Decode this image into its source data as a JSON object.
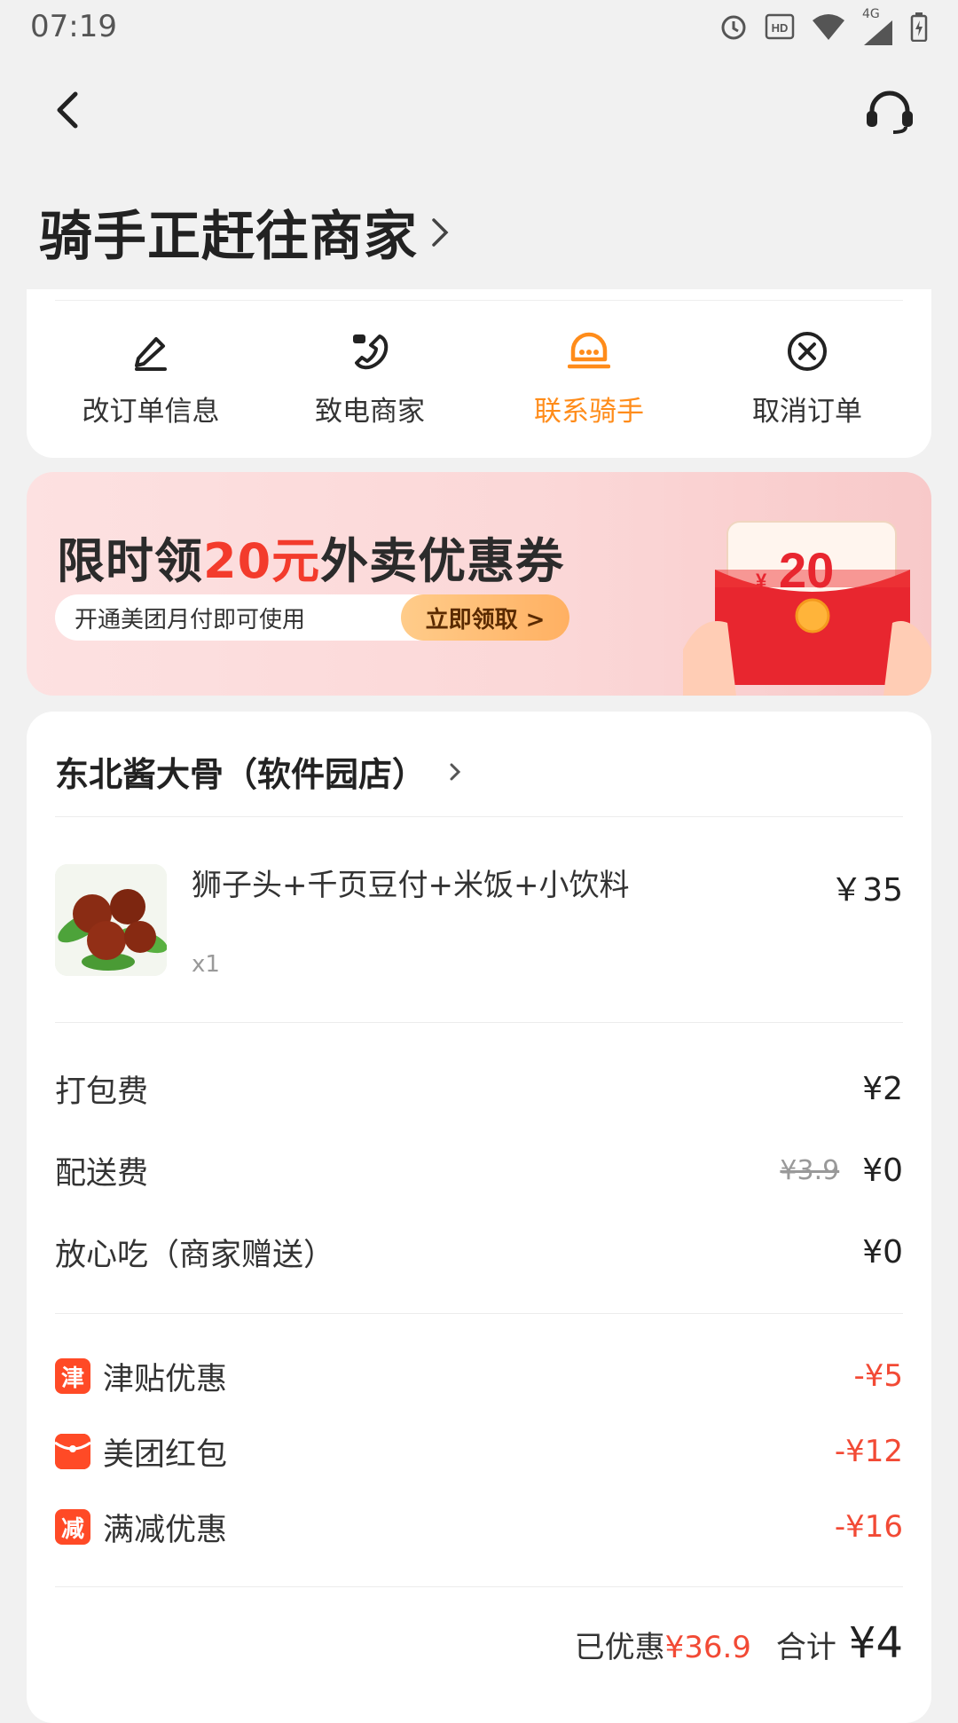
{
  "status_bar": {
    "time": "07:19",
    "network": "4G"
  },
  "header": {
    "title": "骑手正赶往商家"
  },
  "actions": [
    {
      "label": "改订单信息",
      "icon": "pencil-icon"
    },
    {
      "label": "致电商家",
      "icon": "phone-icon"
    },
    {
      "label": "联系骑手",
      "icon": "chat-icon",
      "highlight": "#ff8c1a"
    },
    {
      "label": "取消订单",
      "icon": "cancel-icon"
    }
  ],
  "banner": {
    "title_prefix": "限时领",
    "title_highlight": "20元",
    "title_suffix": "外卖优惠券",
    "subtitle": "开通美团月付即可使用",
    "cta": "立即领取 >",
    "coupon_currency": "¥",
    "coupon_amount": "20"
  },
  "order": {
    "shop_name": "东北酱大骨（软件园店）",
    "item": {
      "name": "狮子头+千页豆付+米饭+小饮料",
      "qty": "x1",
      "price": "￥35"
    },
    "fees": [
      {
        "label": "打包费",
        "value": "¥2"
      },
      {
        "label": "配送费",
        "original": "¥3.9",
        "value": "¥0"
      },
      {
        "label": "放心吃（商家赠送）",
        "value": "¥0"
      }
    ],
    "discounts": [
      {
        "badge": "津",
        "label": "津贴优惠",
        "value": "-¥5"
      },
      {
        "badge": "",
        "label": "美团红包",
        "value": "-¥12"
      },
      {
        "badge": "减",
        "label": "满减优惠",
        "value": "-¥16"
      }
    ],
    "saved_label": "已优惠",
    "saved_value": "¥36.9",
    "total_label": "合计",
    "total_value": "¥4"
  },
  "colors": {
    "accent_orange": "#ff8c1a",
    "discount_red": "#f24a35"
  }
}
